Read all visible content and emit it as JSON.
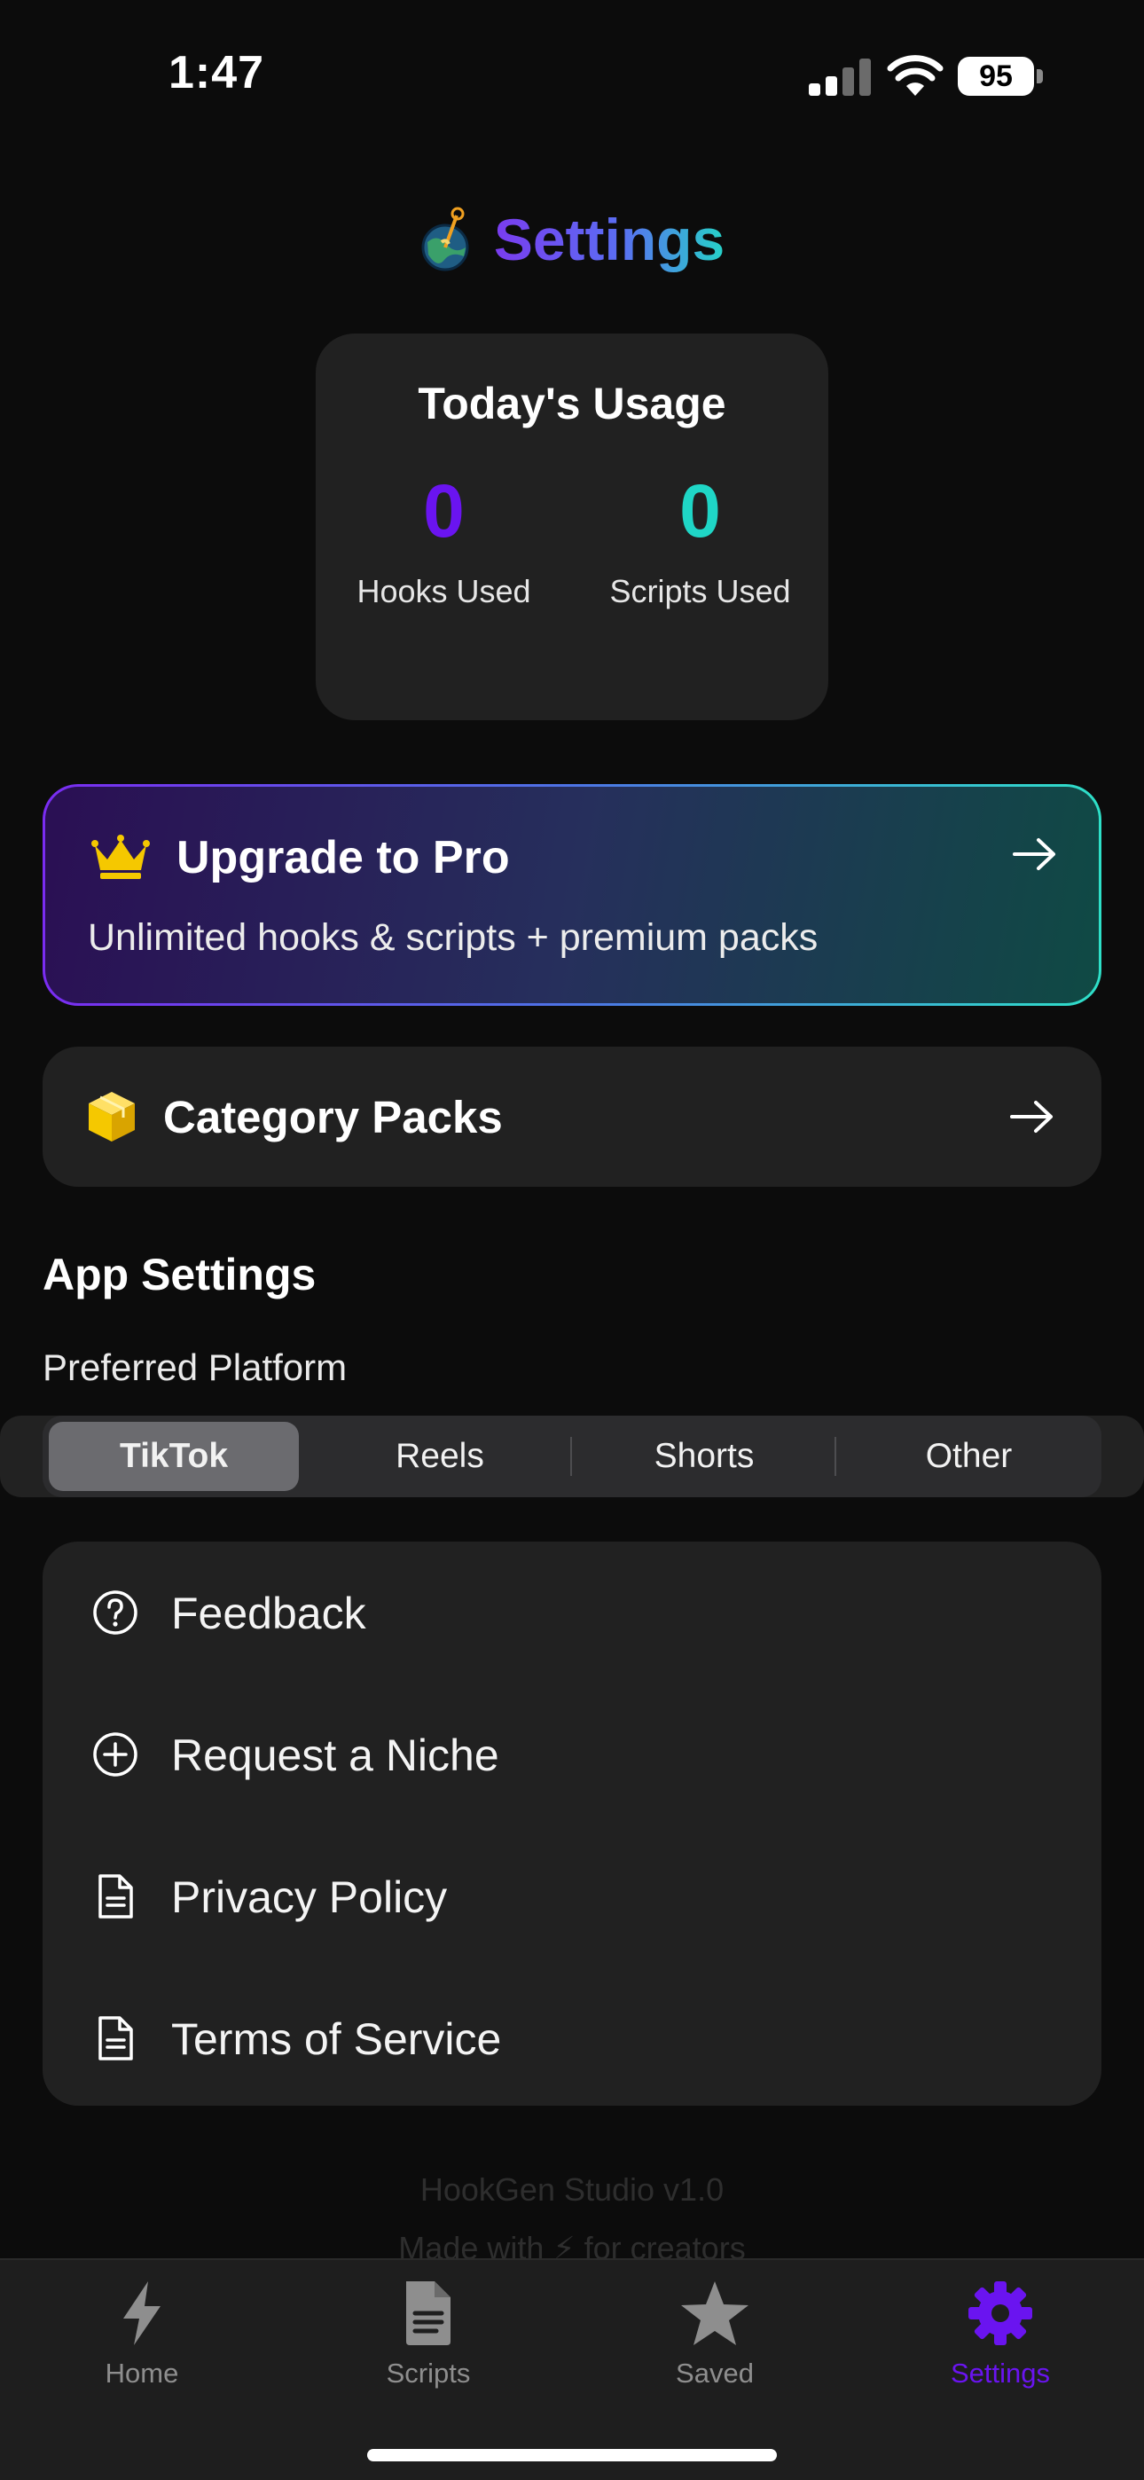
{
  "status_bar": {
    "time": "1:47",
    "battery": "95"
  },
  "header": {
    "title": "Settings",
    "logo_icon": "globe-hook-icon"
  },
  "usage": {
    "title": "Today's Usage",
    "hooks_value": "0",
    "hooks_label": "Hooks Used",
    "scripts_value": "0",
    "scripts_label": "Scripts Used"
  },
  "upgrade": {
    "title": "Upgrade to Pro",
    "subtitle": "Unlimited hooks & scripts + premium packs",
    "icon": "crown-icon"
  },
  "packs": {
    "title": "Category Packs",
    "icon": "package-icon"
  },
  "app_settings": {
    "title": "App Settings",
    "platform_label": "Preferred Platform",
    "platforms": [
      "TikTok",
      "Reels",
      "Shorts",
      "Other"
    ],
    "selected_platform": "TikTok"
  },
  "links": [
    {
      "label": "Feedback",
      "icon": "question-circle-icon"
    },
    {
      "label": "Request a Niche",
      "icon": "plus-circle-icon"
    },
    {
      "label": "Privacy Policy",
      "icon": "document-icon"
    },
    {
      "label": "Terms of Service",
      "icon": "document-icon"
    }
  ],
  "footer": {
    "version": "HookGen Studio v1.0",
    "made_with": "Made with ⚡ for creators"
  },
  "tabs": [
    {
      "label": "Home",
      "icon": "bolt-icon"
    },
    {
      "label": "Scripts",
      "icon": "file-icon"
    },
    {
      "label": "Saved",
      "icon": "star-icon"
    },
    {
      "label": "Settings",
      "icon": "gear-icon"
    }
  ],
  "colors": {
    "accent_purple": "#6a14f0",
    "accent_teal": "#1fd6c6",
    "background": "#0c0c0c",
    "card": "#212121",
    "crown": "#f5c800"
  }
}
